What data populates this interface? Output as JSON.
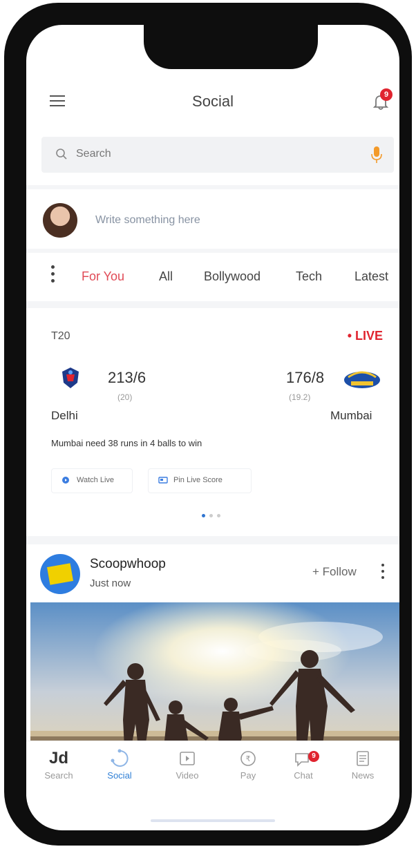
{
  "header": {
    "title": "Social",
    "notification_count": "9"
  },
  "search": {
    "placeholder": "Search"
  },
  "composer": {
    "placeholder": "Write something here"
  },
  "tabs": [
    {
      "label": "For You",
      "active": true
    },
    {
      "label": "All",
      "active": false
    },
    {
      "label": "Bollywood",
      "active": false
    },
    {
      "label": "Tech",
      "active": false
    },
    {
      "label": "Latest",
      "active": false
    }
  ],
  "score_card": {
    "league": "T20",
    "live_label": "• LIVE",
    "team1": {
      "name": "Delhi",
      "runs": "213/6",
      "overs": "(20)"
    },
    "team2": {
      "name": "Mumbai",
      "runs": "176/8",
      "overs": "(19.2)"
    },
    "status": "Mumbai need 38 runs in 4 balls to win",
    "actions": {
      "watch_live": "Watch Live",
      "pin_score": "Pin Live Score"
    }
  },
  "post": {
    "author": "Scoopwhoop",
    "time": "Just now",
    "follow_label": "+ Follow"
  },
  "bottom_nav": {
    "items": [
      {
        "label": "Search",
        "icon": "jd-logo-icon"
      },
      {
        "label": "Social",
        "icon": "social-icon"
      },
      {
        "label": "Video",
        "icon": "video-icon"
      },
      {
        "label": "Pay",
        "icon": "pay-icon"
      },
      {
        "label": "Chat",
        "icon": "chat-icon"
      },
      {
        "label": "News",
        "icon": "news-icon"
      }
    ],
    "chat_badge": "9",
    "jd_logo_text": "Jd"
  },
  "colors": {
    "accent": "#e04a56",
    "live": "#e0242f",
    "active_nav": "#2f7fd6"
  }
}
